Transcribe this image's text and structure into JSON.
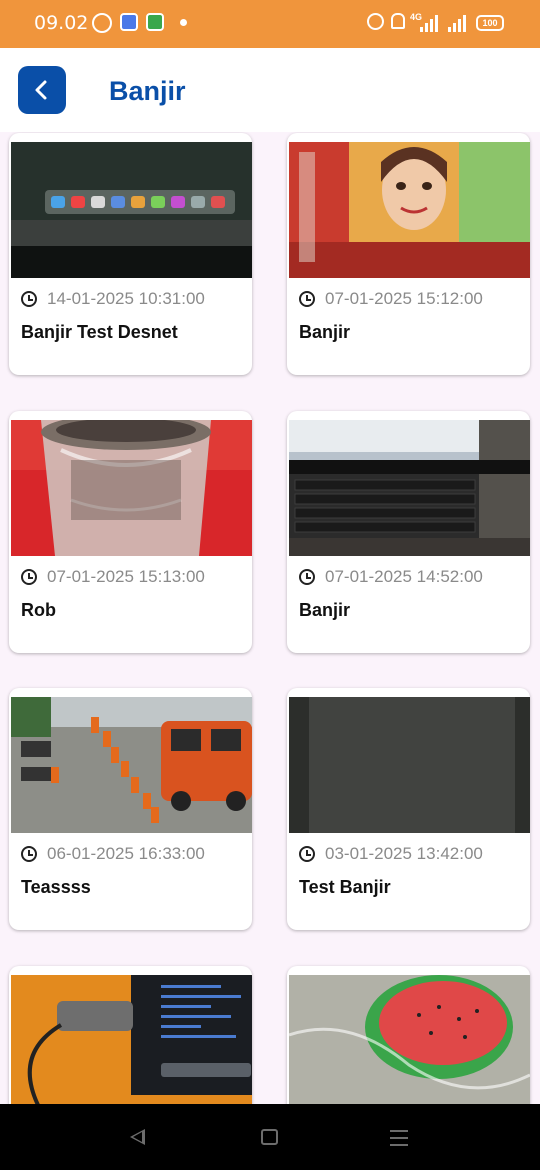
{
  "status_bar": {
    "time": "09.02",
    "network": "4G",
    "battery": "100"
  },
  "header": {
    "title": "Banjir",
    "back_icon": "chevron-left-icon"
  },
  "colors": {
    "status_bar": "#f0953c",
    "brand": "#0a4fa8",
    "date_text": "#8a8a8a"
  },
  "reports": [
    {
      "date": "14-01-2025 10:31:00",
      "title": "Banjir Test Desnet",
      "thumb": "laptop-dock"
    },
    {
      "date": "07-01-2025 15:12:00",
      "title": "Banjir",
      "thumb": "poster-girl"
    },
    {
      "date": "07-01-2025 15:13:00",
      "title": "Rob",
      "thumb": "plastic-cup"
    },
    {
      "date": "07-01-2025 14:52:00",
      "title": "Banjir",
      "thumb": "laptop-keyboard"
    },
    {
      "date": "06-01-2025 16:33:00",
      "title": "Teassss",
      "thumb": "team-outdoor"
    },
    {
      "date": "03-01-2025 13:42:00",
      "title": "Test Banjir",
      "thumb": "dark-surface"
    },
    {
      "date": "",
      "title": "",
      "thumb": "laptop-cable"
    },
    {
      "date": "",
      "title": "",
      "thumb": "watermelon-bag"
    }
  ],
  "nav": {
    "back_icon": "nav-back-icon",
    "home_icon": "nav-home-icon",
    "menu_icon": "nav-recents-icon"
  }
}
